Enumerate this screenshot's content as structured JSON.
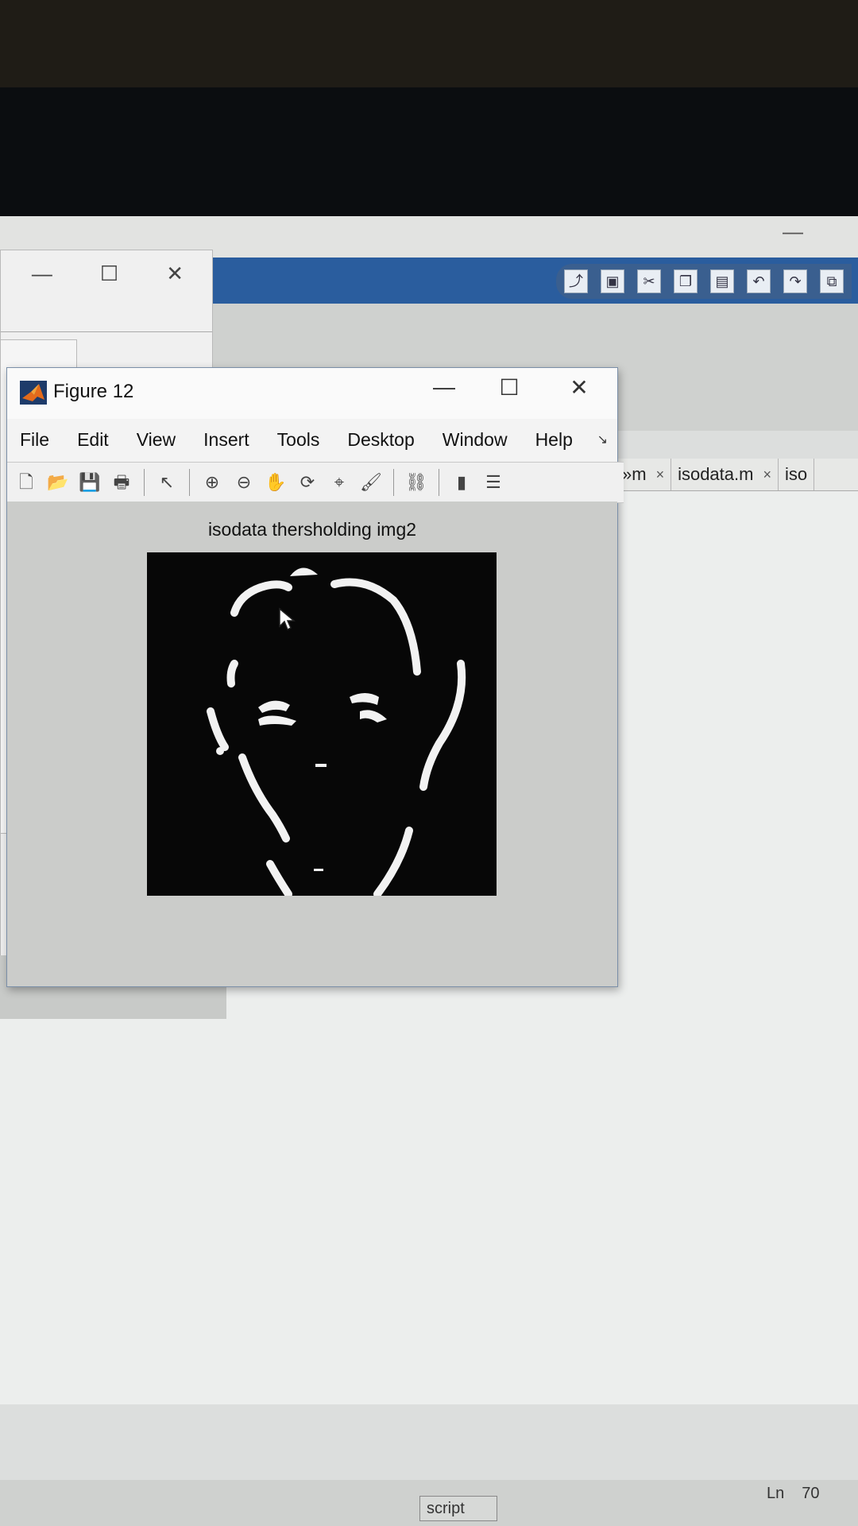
{
  "figure": {
    "title": "Figure 12",
    "controls": {
      "minimize": "—",
      "maximize": "☐",
      "close": "✕"
    },
    "menu": [
      "File",
      "Edit",
      "View",
      "Insert",
      "Tools",
      "Desktop",
      "Window",
      "Help"
    ],
    "toolbar_icons": [
      "new-figure-icon",
      "open-file-icon",
      "save-icon",
      "print-icon",
      "pointer-icon",
      "zoom-in-icon",
      "zoom-out-icon",
      "pan-icon",
      "rotate-3d-icon",
      "data-cursor-icon",
      "brush-icon",
      "link-plot-icon",
      "colorbar-icon",
      "legend-icon"
    ],
    "plot_title": "isodata thersholding img2"
  },
  "editor": {
    "tabs": [
      {
        "label": "»m",
        "close": "×"
      },
      {
        "label": "isodata.m",
        "close": "×"
      },
      {
        "label": "iso",
        "close": ""
      }
    ]
  },
  "status": {
    "mode": "script",
    "ln_label": "Ln",
    "ln_value": "70"
  }
}
